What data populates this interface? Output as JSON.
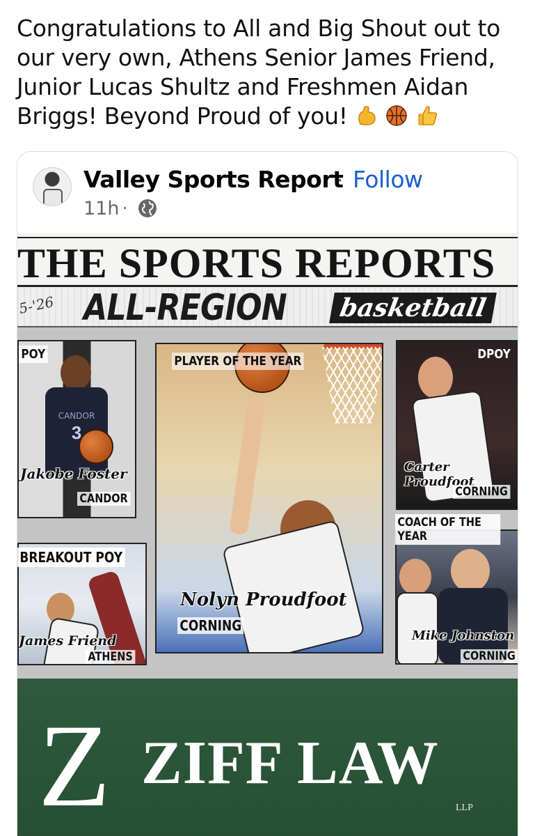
{
  "post": {
    "text": "Congratulations to All and Big Shout out to our very own, Athens Senior James Friend, Junior Lucas Shultz and Freshmen Aidan Briggs! Beyond Proud of you!",
    "emojis": [
      "flexed-biceps",
      "basketball",
      "thumbs-up"
    ]
  },
  "shared_post": {
    "page_name": "Valley Sports Report",
    "separator": "·",
    "follow_label": "Follow",
    "time": "11h",
    "time_separator": "·",
    "audience_icon": "globe-icon"
  },
  "graphic": {
    "masthead": "THE SPORTS REPORTS",
    "year": "5-'26",
    "headline": "ALL-REGION",
    "headline_script": "basketball",
    "panels": {
      "poy": {
        "label": "POY",
        "name": "Jakobe Foster",
        "school": "CANDOR",
        "jersey": "CANDOR",
        "number": "3"
      },
      "player_of_year": {
        "label": "PLAYER OF THE YEAR",
        "name": "Nolyn Proudfoot",
        "school": "CORNING"
      },
      "dpoy": {
        "label": "DPOY",
        "name": "Carter Proudfoot",
        "school": "CORNING"
      },
      "breakout": {
        "label": "BREAKOUT POY",
        "name": "James Friend",
        "school": "ATHENS"
      },
      "coach": {
        "label": "COACH OF THE YEAR",
        "name": "Mike Johnston",
        "school": "CORNING"
      }
    },
    "sponsor": {
      "logo_letter": "Z",
      "name": "ZIFF LAW",
      "suffix": "LLP"
    }
  },
  "colors": {
    "link": "#1a5fd0",
    "meta": "#65676b",
    "sponsor_green": "#2f5a3c"
  }
}
